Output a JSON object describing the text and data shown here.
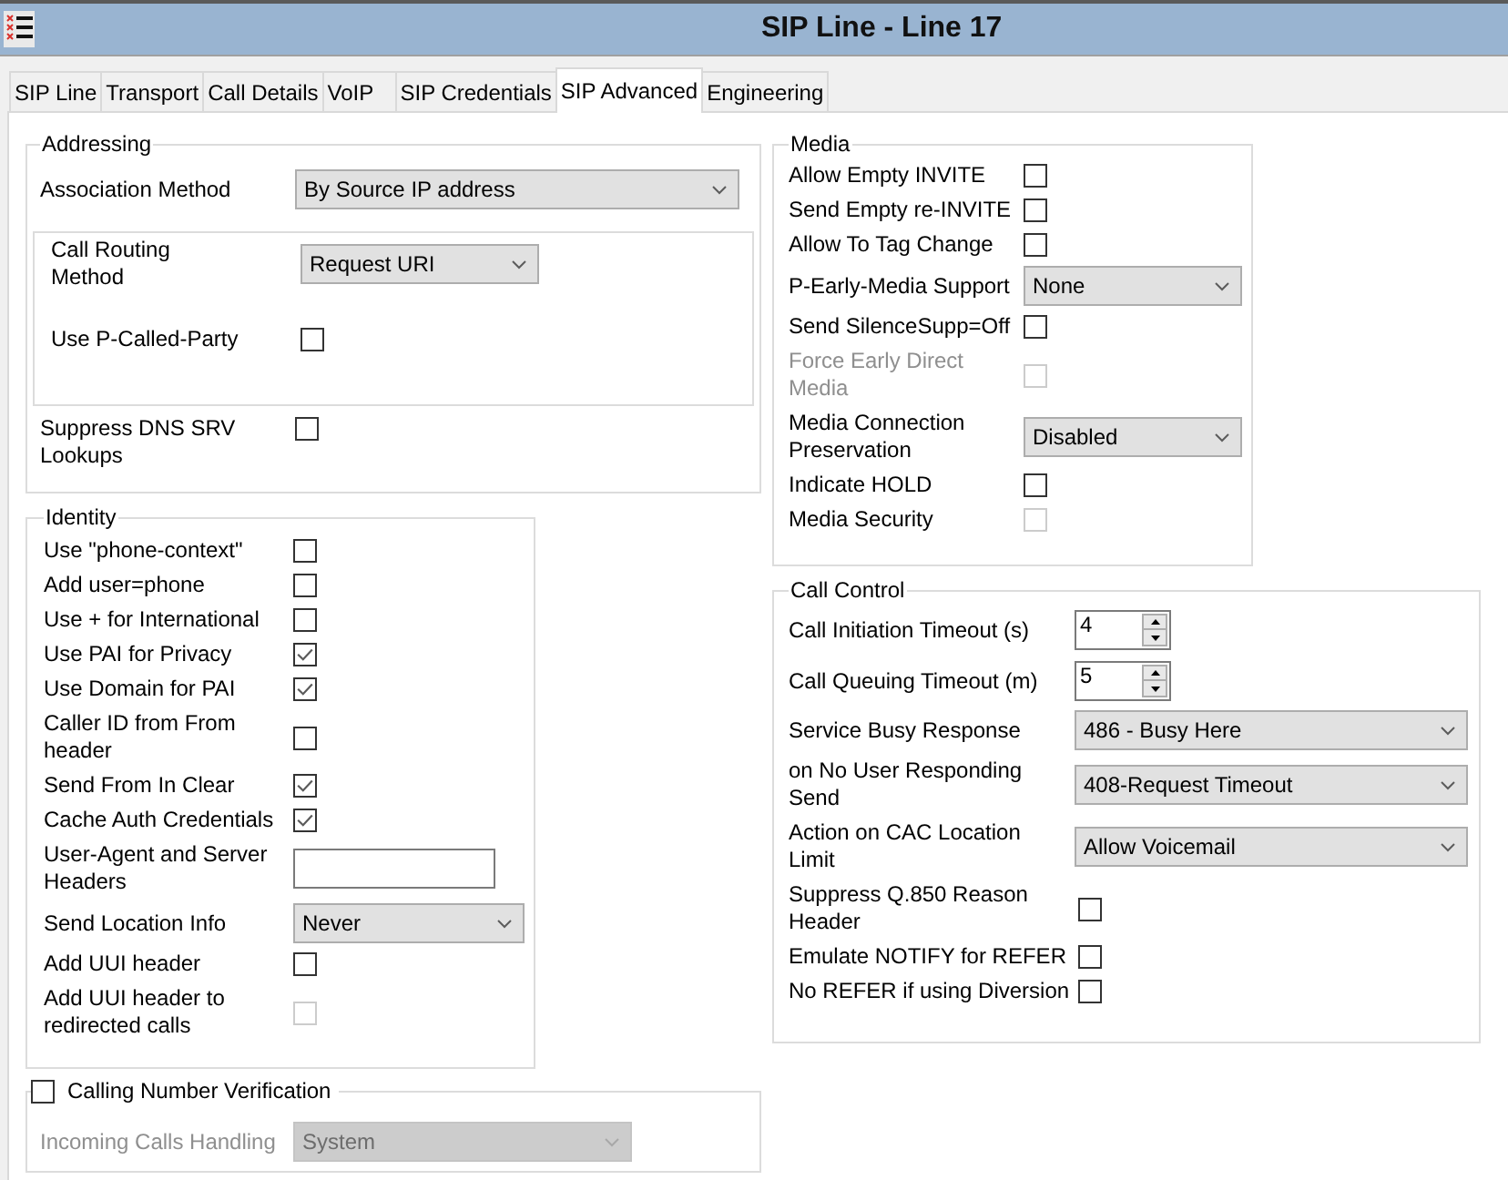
{
  "window": {
    "title": "SIP Line - Line 17"
  },
  "tabs": [
    {
      "label": "SIP Line",
      "selected": false
    },
    {
      "label": "Transport",
      "selected": false
    },
    {
      "label": "Call Details",
      "selected": false
    },
    {
      "label": "VoIP",
      "selected": false
    },
    {
      "label": "SIP Credentials",
      "selected": false
    },
    {
      "label": "SIP Advanced",
      "selected": true
    },
    {
      "label": "Engineering",
      "selected": false
    }
  ],
  "addressing": {
    "title": "Addressing",
    "association_method": {
      "label": "Association Method",
      "value": "By Source IP address"
    },
    "call_routing_method": {
      "label": "Call Routing Method",
      "value": "Request URI"
    },
    "use_p_called_party": {
      "label": "Use P-Called-Party",
      "checked": false
    },
    "suppress_dns_srv_lookups": {
      "label": "Suppress DNS SRV Lookups",
      "checked": false
    }
  },
  "identity": {
    "title": "Identity",
    "rows": [
      {
        "kind": "check",
        "label": "Use \"phone-context\"",
        "checked": false,
        "disabled": false
      },
      {
        "kind": "check",
        "label": "Add user=phone",
        "checked": false,
        "disabled": false
      },
      {
        "kind": "check",
        "label": "Use + for International",
        "checked": false,
        "disabled": false
      },
      {
        "kind": "check",
        "label": "Use PAI for Privacy",
        "checked": true,
        "disabled": false
      },
      {
        "kind": "check",
        "label": "Use Domain for PAI",
        "checked": true,
        "disabled": false
      },
      {
        "kind": "check",
        "label": "Caller ID from From header",
        "checked": false,
        "disabled": false
      },
      {
        "kind": "check",
        "label": "Send From In Clear",
        "checked": true,
        "disabled": false
      },
      {
        "kind": "check",
        "label": "Cache Auth Credentials",
        "checked": true,
        "disabled": false
      },
      {
        "kind": "text",
        "label": "User-Agent and Server Headers",
        "disabled": false
      },
      {
        "kind": "select",
        "label": "Send Location Info",
        "value": "Never",
        "disabled": false
      },
      {
        "kind": "check",
        "label": "Add UUI header",
        "checked": false,
        "disabled": false
      },
      {
        "kind": "check",
        "label": "Add UUI header to redirected calls",
        "checked": false,
        "disabled": true
      }
    ]
  },
  "calling_number_verification": {
    "label": "Calling Number Verification",
    "checked": false,
    "incoming_calls_handling": {
      "label": "Incoming Calls Handling",
      "value": "System",
      "disabled": true
    }
  },
  "media": {
    "title": "Media",
    "rows": [
      {
        "kind": "check",
        "label": "Allow Empty INVITE",
        "checked": false,
        "disabled": false,
        "label_greyed": false
      },
      {
        "kind": "check",
        "label": "Send Empty re-INVITE",
        "checked": false,
        "disabled": false,
        "label_greyed": false
      },
      {
        "kind": "check",
        "label": "Allow To Tag Change",
        "checked": false,
        "disabled": false,
        "label_greyed": false
      },
      {
        "kind": "select",
        "label": "P-Early-Media Support",
        "value": "None",
        "disabled": false,
        "label_greyed": false
      },
      {
        "kind": "check",
        "label": "Send SilenceSupp=Off",
        "checked": false,
        "disabled": false,
        "label_greyed": false
      },
      {
        "kind": "check",
        "label": "Force Early Direct Media",
        "checked": false,
        "disabled": true,
        "label_greyed": true
      },
      {
        "kind": "select",
        "label": "Media Connection Preservation",
        "value": "Disabled",
        "disabled": false,
        "label_greyed": false
      },
      {
        "kind": "check",
        "label": "Indicate HOLD",
        "checked": false,
        "disabled": false,
        "label_greyed": false
      },
      {
        "kind": "check",
        "label": "Media Security",
        "checked": false,
        "disabled": true,
        "label_greyed": false
      }
    ]
  },
  "call_control": {
    "title": "Call Control",
    "rows": [
      {
        "kind": "spin",
        "label": "Call Initiation Timeout (s)",
        "value": "4"
      },
      {
        "kind": "spin",
        "label": "Call Queuing Timeout (m)",
        "value": "5"
      },
      {
        "kind": "select",
        "label": "Service Busy Response",
        "value": "486 - Busy Here"
      },
      {
        "kind": "select",
        "label": "on No User Responding Send",
        "value": "408-Request Timeout"
      },
      {
        "kind": "select",
        "label": "Action on CAC Location Limit",
        "value": "Allow Voicemail"
      },
      {
        "kind": "check",
        "label": "Suppress Q.850 Reason Header",
        "checked": false
      },
      {
        "kind": "check",
        "label": "Emulate NOTIFY for REFER",
        "checked": false
      },
      {
        "kind": "check",
        "label": "No REFER if using Diversion",
        "checked": false
      }
    ]
  }
}
